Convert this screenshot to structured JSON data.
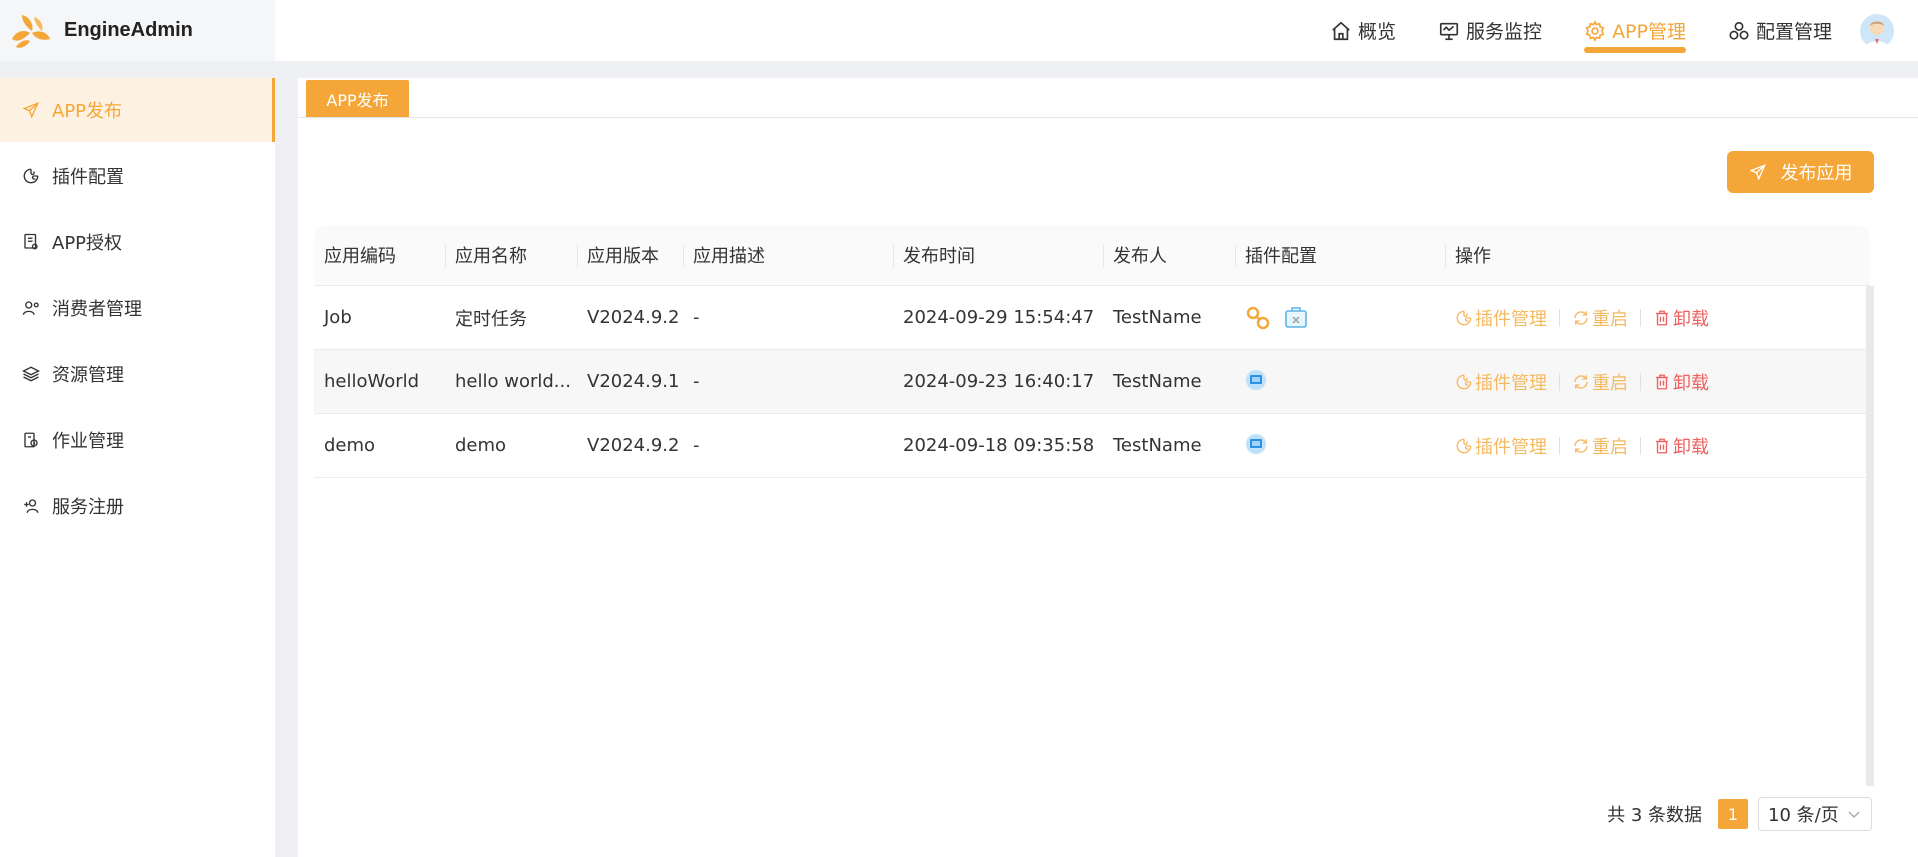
{
  "app": {
    "name": "EngineAdmin"
  },
  "topnav": [
    {
      "label": "概览",
      "icon": "home-icon"
    },
    {
      "label": "服务监控",
      "icon": "monitor-icon"
    },
    {
      "label": "APP管理",
      "icon": "gear-icon",
      "active": true
    },
    {
      "label": "配置管理",
      "icon": "config-icon"
    }
  ],
  "sidebar": {
    "items": [
      {
        "label": "APP发布",
        "icon": "send-icon",
        "active": true
      },
      {
        "label": "插件配置",
        "icon": "puzzle-icon"
      },
      {
        "label": "APP授权",
        "icon": "document-icon"
      },
      {
        "label": "消费者管理",
        "icon": "user-settings-icon"
      },
      {
        "label": "资源管理",
        "icon": "layers-icon"
      },
      {
        "label": "作业管理",
        "icon": "job-icon"
      },
      {
        "label": "服务注册",
        "icon": "user-add-icon"
      }
    ]
  },
  "tabs": [
    {
      "label": "APP发布"
    }
  ],
  "toolbar": {
    "publish_label": "发布应用"
  },
  "table": {
    "headers": [
      "应用编码",
      "应用名称",
      "应用版本",
      "应用描述",
      "发布时间",
      "发布人",
      "插件配置",
      "操作"
    ],
    "rows": [
      {
        "code": "Job",
        "name": "定时任务",
        "version": "V2024.9.2",
        "desc": "-",
        "time": "2024-09-29 15:54:47",
        "publisher": "TestName"
      },
      {
        "code": "helloWorld",
        "name": "hello world...",
        "version": "V2024.9.1",
        "desc": "-",
        "time": "2024-09-23 16:40:17",
        "publisher": "TestName"
      },
      {
        "code": "demo",
        "name": "demo",
        "version": "V2024.9.2",
        "desc": "-",
        "time": "2024-09-18 09:35:58",
        "publisher": "TestName"
      }
    ],
    "actions": {
      "plugin": "插件管理",
      "restart": "重启",
      "uninstall": "卸载"
    }
  },
  "pagination": {
    "total_text": "共 3 条数据",
    "current": "1",
    "page_size": "10 条/页"
  },
  "colors": {
    "accent": "#f5a638",
    "danger": "#f06060"
  }
}
